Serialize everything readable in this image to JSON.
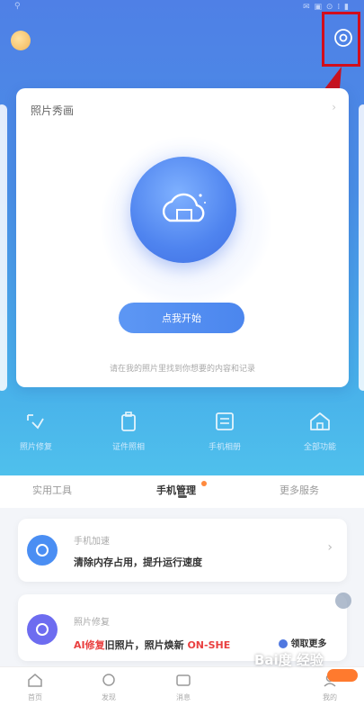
{
  "status": {
    "left": "⚲",
    "right": "✉ ▣  ⊙ ⁞ ▮"
  },
  "card": {
    "title": "照片秀画",
    "button_label": "点我开始",
    "hint": "请在我的照片里找到你想要的内容和记录"
  },
  "tools": [
    {
      "label": "照片修复",
      "icon": "photo-repair-icon"
    },
    {
      "label": "证件照相",
      "icon": "id-photo-icon"
    },
    {
      "label": "手机相册",
      "icon": "album-icon"
    },
    {
      "label": "全部功能",
      "icon": "home-icon"
    }
  ],
  "tabs": [
    {
      "label": "实用工具"
    },
    {
      "label": "手机管理"
    },
    {
      "label": "更多服务"
    }
  ],
  "list": [
    {
      "label": "手机加速",
      "text": "清除内存占用，提升运行速度"
    },
    {
      "label": "照片修复",
      "text_red": "AI修复",
      "text_mid": "旧照片，照片焕新",
      "text_red2": "ON-SHE",
      "promo": "领取更多"
    }
  ],
  "bottom_nav": [
    "首页",
    "发现",
    "消息",
    "我的"
  ],
  "watermark": "Bai度 经验",
  "colors": {
    "accent": "#4f84ef",
    "highlight": "#d20d1c",
    "hero_top": "#4f80e6",
    "hero_bottom": "#4fc0ec"
  }
}
